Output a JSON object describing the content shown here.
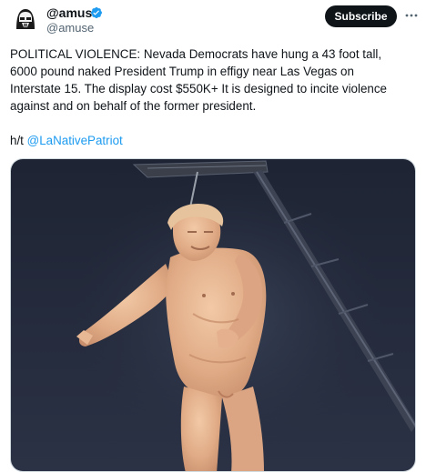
{
  "author": {
    "display_name": "@amuse",
    "handle": "@amuse",
    "verified": true,
    "avatar_icon": "stormtrooper-avatar-icon"
  },
  "actions": {
    "subscribe_label": "Subscribe",
    "more_icon": "more-horizontal-icon"
  },
  "post": {
    "text": "POLITICAL VIOLENCE: Nevada Democrats have hung a 43 foot tall,\n6000 pound naked President Trump in effigy near Las Vegas on\nInterstate 15. The display cost $550K+ It is designed to incite violence\nagainst and on behalf of the former president.",
    "ht_prefix": "h/t ",
    "mention": "@LaNativePatriot"
  },
  "colors": {
    "verified_badge": "#1d9bf0",
    "link": "#1d9bf0",
    "subscribe_bg": "#0f1419"
  }
}
